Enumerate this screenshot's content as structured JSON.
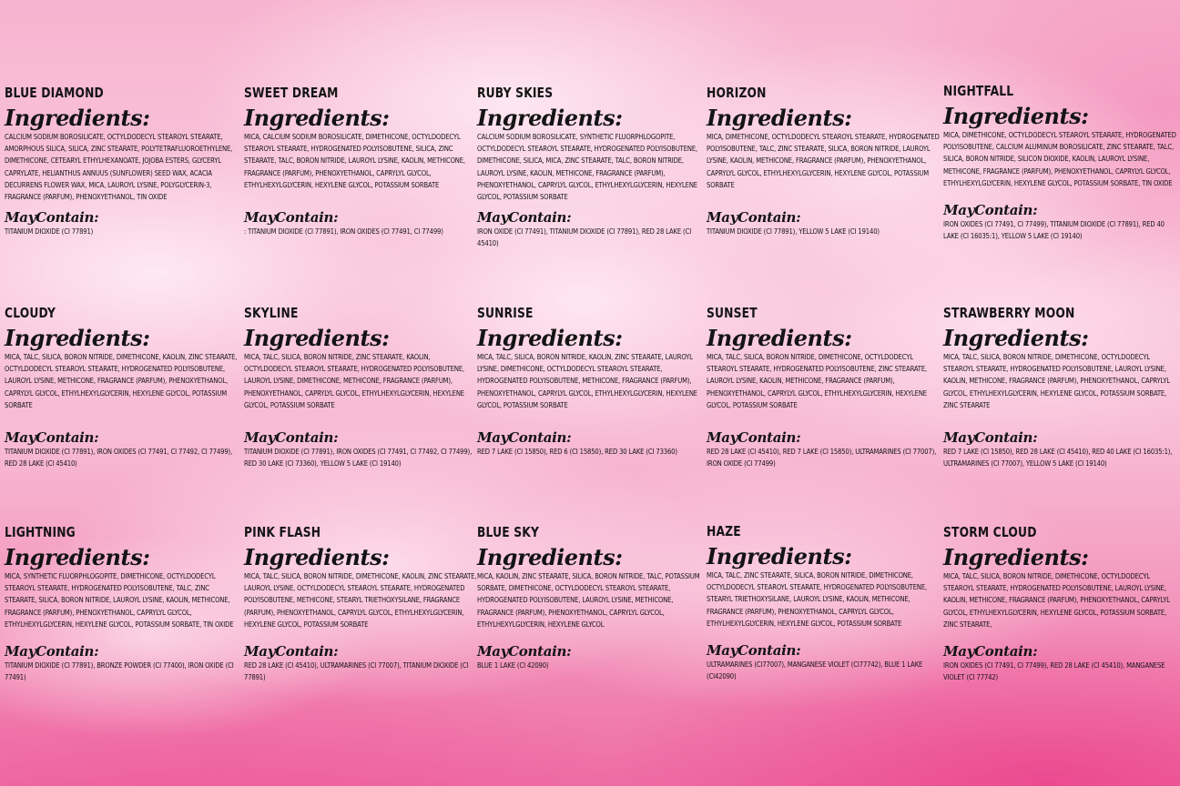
{
  "labels": {
    "ingredients": "Ingredients:",
    "may_contain": "MayContain:"
  },
  "products": [
    {
      "name": "BLUE DIAMOND",
      "ingredients": "CALCIUM SODIUM BOROSILICATE, OCTYLDODECYL STEAROYL STEARATE, AMORPHOUS SILICA, SILICA, ZINC STEARATE, POLYTETRAFLUOROETHYLENE, DIMETHICONE, CETEARYL ETHYLHEXANOATE, JOJOBA ESTERS, GLYCERYL CAPRYLATE, HELIANTHUS ANNUUS (SUNFLOWER) SEED WAX, ACACIA DECURRENS FLOWER WAX, MICA, LAUROYL LYSINE, POLYGLYCERIN-3, FRAGRANCE (PARFUM), PHENOXYETHANOL, TIN OXIDE",
      "may_contain": "TITANIUM DIOXIDE (CI 77891)"
    },
    {
      "name": "SWEET DREAM",
      "ingredients": "MICA, CALCIUM SODIUM BOROSILICATE, DIMETHICONE, OCTYLDODECYL STEAROYL STEARATE, HYDROGENATED POLYISOBUTENE, SILICA, ZINC STEARATE, TALC, BORON NITRIDE, LAUROYL LYSINE, KAOLIN, METHICONE, FRAGRANCE (PARFUM), PHENOXYETHANOL, CAPRYLYL GLYCOL, ETHYLHEXYLGLYCERIN, HEXYLENE GLYCOL, POTASSIUM SORBATE",
      "may_contain": ": TITANIUM DIOXIDE (CI 77891), IRON OXIDES (CI 77491, CI 77499)"
    },
    {
      "name": "RUBY SKIES",
      "ingredients": "CALCIUM SODIUM BOROSILICATE, SYNTHETIC FLUORPHLOGOPITE, OCTYLDODECYL STEAROYL STEARATE, HYDROGENATED POLYISOBUTENE, DIMETHICONE, SILICA, MICA, ZINC STEARATE, TALC, BORON NITRIDE, LAUROYL LYSINE, KAOLIN, METHICONE, FRAGRANCE (PARFUM), PHENOXYETHANOL, CAPRYLYL GLYCOL, ETHYLHEXYLGLYCERIN, HEXYLENE GLYCOL, POTASSIUM SORBATE",
      "may_contain": "IRON OXIDE (CI 77491), TITANIUM DIOXIDE (CI 77891), RED 28 LAKE (CI 45410)"
    },
    {
      "name": "HORIZON",
      "ingredients": "MICA, DIMETHICONE, OCTYLDODECYL STEAROYL STEARATE, HYDROGENATED POLYISOBUTENE, TALC, ZINC STEARATE, SILICA, BORON NITRIDE, LAUROYL LYSINE, KAOLIN, METHICONE, FRAGRANCE (PARFUM), PHENOXYETHANOL, CAPRYLYL GLYCOL, ETHYLHEXYLGLYCERIN, HEXYLENE GLYCOL, POTASSIUM SORBATE",
      "may_contain": "TITANIUM DIOXIDE (CI 77891), YELLOW 5 LAKE (CI 19140)"
    },
    {
      "name": "NIGHTFALL",
      "ingredients": "MICA, DIMETHICONE, OCTYLDODECYL STEAROYL STEARATE, HYDROGENATED POLYISOBUTENE, CALCIUM ALUMINUM BOROSILICATE, ZINC STEARATE, TALC, SILICA, BORON NITRIDE, SILICON DIOXIDE, KAOLIN, LAUROYL LYSINE, METHICONE, FRAGRANCE (PARFUM), PHENOXYETHANOL, CAPRYLYL GLYCOL, ETHYLHEXYLGLYCERIN, HEXYLENE GLYCOL, POTASSIUM SORBATE, TIN OXIDE",
      "may_contain": "IRON OXIDES (CI 77491, CI 77499), TITANIUM DIOXIDE (CI 77891), RED 40 LAKE (CI 16035:1), YELLOW 5 LAKE (CI 19140)"
    },
    {
      "name": "CLOUDY",
      "ingredients": "MICA, TALC, SILICA, BORON NITRIDE, DIMETHICONE, KAOLIN, ZINC STEARATE, OCTYLDODECYL STEAROYL STEARATE, HYDROGENATED POLYISOBUTENE, LAUROYL LYSINE, METHICONE, FRAGRANCE (PARFUM), PHENOXYETHANOL, CAPRYLYL GLYCOL, ETHYLHEXYLGLYCERIN, HEXYLENE GLYCOL, POTASSIUM SORBATE",
      "may_contain": "TITANIUM DIOXIDE (CI 77891), IRON OXIDES (CI 77491, CI 77492, CI 77499), RED 28 LAKE (CI 45410)"
    },
    {
      "name": "SKYLINE",
      "ingredients": "MICA, TALC, SILICA, BORON NITRIDE, ZINC STEARATE, KAOLIN, OCTYLDODECYL STEAROYL STEARATE, HYDROGENATED POLYISOBUTENE, LAUROYL LYSINE, DIMETHICONE, METHICONE, FRAGRANCE (PARFUM), PHENOXYETHANOL, CAPRYLYL GLYCOL, ETHYLHEXYLGLYCERIN, HEXYLENE GLYCOL, POTASSIUM SORBATE",
      "may_contain": "TITANIUM DIOXIDE (CI 77891), IRON OXIDES (CI 77491, CI 77492, CI 77499), RED 30 LAKE (CI 73360), YELLOW 5 LAKE (CI 19140)"
    },
    {
      "name": "SUNRISE",
      "ingredients": "MICA, TALC, SILICA, BORON NITRIDE, KAOLIN, ZINC STEARATE, LAUROYL LYSINE, DIMETHICONE, OCTYLDODECYL STEAROYL STEARATE, HYDROGENATED POLYISOBUTENE, METHICONE, FRAGRANCE (PARFUM), PHENOXYETHANOL, CAPRYLYL GLYCOL, ETHYLHEXYLGLYCERIN, HEXYLENE GLYCOL, POTASSIUM SORBATE",
      "may_contain": "RED 7 LAKE (CI 15850), RED 6 (CI 15850), RED 30 LAKE (CI 73360)"
    },
    {
      "name": "SUNSET",
      "ingredients": "MICA, TALC, SILICA, BORON NITRIDE, DIMETHICONE, OCTYLDODECYL STEAROYL STEARATE, HYDROGENATED POLYISOBUTENE, ZINC STEARATE, LAUROYL LYSINE, KAOLIN, METHICONE, FRAGRANCE (PARFUM), PHENOXYETHANOL, CAPRYLYL GLYCOL, ETHYLHEXYLGLYCERIN, HEXYLENE GLYCOL, POTASSIUM SORBATE",
      "may_contain": "RED 28 LAKE (CI 45410), RED 7 LAKE (CI 15850), ULTRAMARINES (CI 77007), IRON OXIDE (CI 77499)"
    },
    {
      "name": "STRAWBERRY MOON",
      "ingredients": "MICA, TALC, SILICA, BORON NITRIDE, DIMETHICONE, OCTYLDODECYL STEAROYL STEARATE, HYDROGENATED POLYISOBUTENE, LAUROYL LYSINE, KAOLIN, METHICONE, FRAGRANCE (PARFUM), PHENOXYETHANOL, CAPRYLYL GLYCOL, ETHYLHEXYLGLYCERIN, HEXYLENE GLYCOL, POTASSIUM SORBATE, ZINC STEARATE",
      "may_contain": "RED 7 LAKE (CI 15850), RED 28 LAKE (CI 45410), RED 40 LAKE (CI 16035:1), ULTRAMARINES (CI 77007), YELLOW 5 LAKE (CI 19140)"
    },
    {
      "name": "LIGHTNING",
      "ingredients": "MICA, SYNTHETIC FLUORPHLOGOPITE, DIMETHICONE, OCTYLDODECYL STEAROYL STEARATE, HYDROGENATED POLYISOBUTENE, TALC, ZINC STEARATE, SILICA, BORON NITRIDE, LAUROYL LYSINE, KAOLIN, METHICONE, FRAGRANCE (PARFUM), PHENOXYETHANOL, CAPRYLYL GLYCOL, ETHYLHEXYLGLYCERIN, HEXYLENE GLYCOL, POTASSIUM SORBATE, TIN OXIDE",
      "may_contain": "TITANIUM DIOXIDE (CI 77891), BRONZE POWDER (CI 77400), IRON OXIDE (CI 77491)"
    },
    {
      "name": "PINK FLASH",
      "ingredients": "MICA, TALC, SILICA, BORON NITRIDE, DIMETHICONE, KAOLIN, ZINC STEARATE, LAUROYL LYSINE, OCTYLDODECYL STEAROYL STEARATE, HYDROGENATED POLYISOBUTENE, METHICONE, STEARYL TRIETHOXYSILANE, FRAGRANCE (PARFUM), PHENOXYETHANOL, CAPRYLYL GLYCOL, ETHYLHEXYLGLYCERIN, HEXYLENE GLYCOL, POTASSIUM SORBATE",
      "may_contain": "RED 28 LAKE (CI 45410), ULTRAMARINES (CI 77007), TITANIUM DIOXIDE (CI 77891)"
    },
    {
      "name": "BLUE SKY",
      "ingredients": "MICA, KAOLIN, ZINC STEARATE, SILICA, BORON NITRIDE, TALC, POTASSIUM SORBATE, DIMETHICONE, OCTYLDODECYL STEAROYL STEARATE, HYDROGENATED POLYISOBUTENE, LAUROYL LYSINE, METHICONE, FRAGRANCE (PARFUM), PHENOXYETHANOL, CAPRYLYL GLYCOL, ETHYLHEXYLGLYCERIN, HEXYLENE GLYCOL",
      "may_contain": "BLUE 1 LAKE (CI 42090)"
    },
    {
      "name": "HAZE",
      "ingredients": "MICA, TALC, ZINC STEARATE, SILICA, BORON NITRIDE, DIMETHICONE, OCTYLDODECYL STEAROYL STEARATE, HYDROGENATED POLYISOBUTENE, STEARYL TRIETHOXYSILANE, LAUROYL LYSINE, KAOLIN, METHICONE, FRAGRANCE (PARFUM), PHENOXYETHANOL, CAPRYLYL GLYCOL, ETHYLHEXYLGLYCERIN, HEXYLENE GLYCOL, POTASSIUM SORBATE",
      "may_contain": "ULTRAMARINES (CI77007), MANGANESE VIOLET (CI77742), BLUE 1 LAKE (CI42090)"
    },
    {
      "name": "STORM CLOUD",
      "ingredients": "MICA, TALC, SILICA, BORON NITRIDE, DIMETHICONE, OCTYLDODECYL STEAROYL STEARATE, HYDROGENATED POLYISOBUTENE, LAUROYL LYSINE, KAOLIN, METHICONE, FRAGRANCE (PARFUM), PHENOXYETHANOL, CAPRYLYL GLYCOL, ETHYLHEXYLGLYCERIN, HEXYLENE GLYCOL, POTASSIUM SORBATE, ZINC STEARATE,",
      "may_contain": "IRON OXIDES (CI 77491, CI 77499), RED 28 LAKE (CI 45410), MANGANESE VIOLET (CI 77742)"
    }
  ]
}
